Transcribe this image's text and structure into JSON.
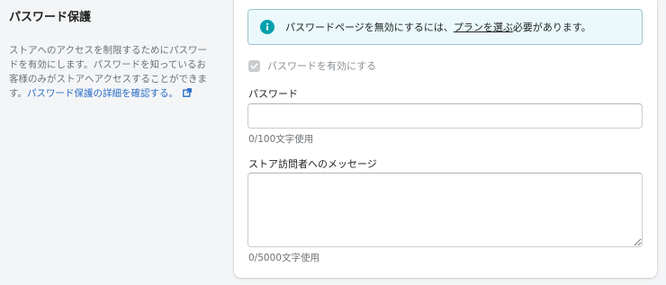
{
  "section": {
    "title": "パスワード保護",
    "description": "ストアへのアクセスを制限するためにパスワードを有効にします。パスワードを知っているお客様のみがストアへアクセスすることができます。",
    "learn_more_link": "パスワード保護の詳細を確認する。"
  },
  "banner": {
    "text_before": "パスワードページを無効にするには、",
    "link": "プランを選ぶ",
    "text_after": "必要があります。"
  },
  "checkbox": {
    "label": "パスワードを有効にする",
    "checked": true,
    "disabled": true
  },
  "password": {
    "label": "パスワード",
    "value": "",
    "counter": "0/100文字使用"
  },
  "message": {
    "label": "ストア訪問者へのメッセージ",
    "value": "",
    "counter": "0/5000文字使用"
  },
  "colors": {
    "link": "#2c6ecb",
    "info": "#00a0ac",
    "banner_bg": "#ebf9fc"
  }
}
